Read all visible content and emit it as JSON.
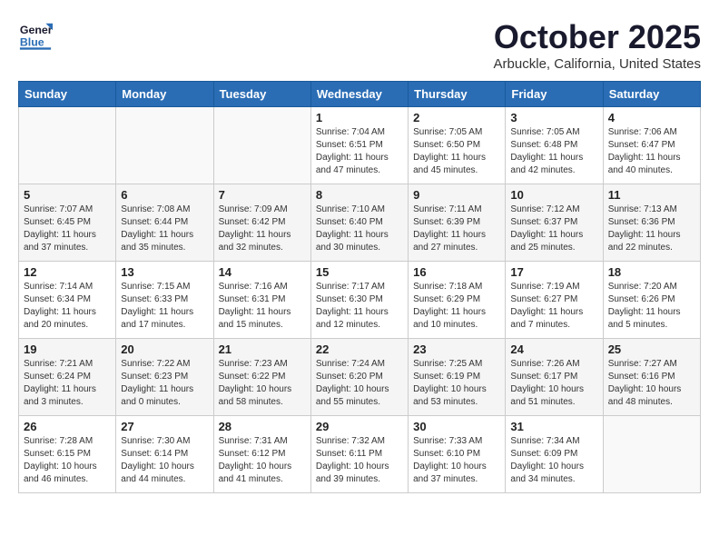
{
  "header": {
    "logo_general": "General",
    "logo_blue": "Blue",
    "month_title": "October 2025",
    "location": "Arbuckle, California, United States"
  },
  "weekdays": [
    "Sunday",
    "Monday",
    "Tuesday",
    "Wednesday",
    "Thursday",
    "Friday",
    "Saturday"
  ],
  "weeks": [
    [
      {
        "day": "",
        "sunrise": "",
        "sunset": "",
        "daylight": ""
      },
      {
        "day": "",
        "sunrise": "",
        "sunset": "",
        "daylight": ""
      },
      {
        "day": "",
        "sunrise": "",
        "sunset": "",
        "daylight": ""
      },
      {
        "day": "1",
        "sunrise": "Sunrise: 7:04 AM",
        "sunset": "Sunset: 6:51 PM",
        "daylight": "Daylight: 11 hours and 47 minutes."
      },
      {
        "day": "2",
        "sunrise": "Sunrise: 7:05 AM",
        "sunset": "Sunset: 6:50 PM",
        "daylight": "Daylight: 11 hours and 45 minutes."
      },
      {
        "day": "3",
        "sunrise": "Sunrise: 7:05 AM",
        "sunset": "Sunset: 6:48 PM",
        "daylight": "Daylight: 11 hours and 42 minutes."
      },
      {
        "day": "4",
        "sunrise": "Sunrise: 7:06 AM",
        "sunset": "Sunset: 6:47 PM",
        "daylight": "Daylight: 11 hours and 40 minutes."
      }
    ],
    [
      {
        "day": "5",
        "sunrise": "Sunrise: 7:07 AM",
        "sunset": "Sunset: 6:45 PM",
        "daylight": "Daylight: 11 hours and 37 minutes."
      },
      {
        "day": "6",
        "sunrise": "Sunrise: 7:08 AM",
        "sunset": "Sunset: 6:44 PM",
        "daylight": "Daylight: 11 hours and 35 minutes."
      },
      {
        "day": "7",
        "sunrise": "Sunrise: 7:09 AM",
        "sunset": "Sunset: 6:42 PM",
        "daylight": "Daylight: 11 hours and 32 minutes."
      },
      {
        "day": "8",
        "sunrise": "Sunrise: 7:10 AM",
        "sunset": "Sunset: 6:40 PM",
        "daylight": "Daylight: 11 hours and 30 minutes."
      },
      {
        "day": "9",
        "sunrise": "Sunrise: 7:11 AM",
        "sunset": "Sunset: 6:39 PM",
        "daylight": "Daylight: 11 hours and 27 minutes."
      },
      {
        "day": "10",
        "sunrise": "Sunrise: 7:12 AM",
        "sunset": "Sunset: 6:37 PM",
        "daylight": "Daylight: 11 hours and 25 minutes."
      },
      {
        "day": "11",
        "sunrise": "Sunrise: 7:13 AM",
        "sunset": "Sunset: 6:36 PM",
        "daylight": "Daylight: 11 hours and 22 minutes."
      }
    ],
    [
      {
        "day": "12",
        "sunrise": "Sunrise: 7:14 AM",
        "sunset": "Sunset: 6:34 PM",
        "daylight": "Daylight: 11 hours and 20 minutes."
      },
      {
        "day": "13",
        "sunrise": "Sunrise: 7:15 AM",
        "sunset": "Sunset: 6:33 PM",
        "daylight": "Daylight: 11 hours and 17 minutes."
      },
      {
        "day": "14",
        "sunrise": "Sunrise: 7:16 AM",
        "sunset": "Sunset: 6:31 PM",
        "daylight": "Daylight: 11 hours and 15 minutes."
      },
      {
        "day": "15",
        "sunrise": "Sunrise: 7:17 AM",
        "sunset": "Sunset: 6:30 PM",
        "daylight": "Daylight: 11 hours and 12 minutes."
      },
      {
        "day": "16",
        "sunrise": "Sunrise: 7:18 AM",
        "sunset": "Sunset: 6:29 PM",
        "daylight": "Daylight: 11 hours and 10 minutes."
      },
      {
        "day": "17",
        "sunrise": "Sunrise: 7:19 AM",
        "sunset": "Sunset: 6:27 PM",
        "daylight": "Daylight: 11 hours and 7 minutes."
      },
      {
        "day": "18",
        "sunrise": "Sunrise: 7:20 AM",
        "sunset": "Sunset: 6:26 PM",
        "daylight": "Daylight: 11 hours and 5 minutes."
      }
    ],
    [
      {
        "day": "19",
        "sunrise": "Sunrise: 7:21 AM",
        "sunset": "Sunset: 6:24 PM",
        "daylight": "Daylight: 11 hours and 3 minutes."
      },
      {
        "day": "20",
        "sunrise": "Sunrise: 7:22 AM",
        "sunset": "Sunset: 6:23 PM",
        "daylight": "Daylight: 11 hours and 0 minutes."
      },
      {
        "day": "21",
        "sunrise": "Sunrise: 7:23 AM",
        "sunset": "Sunset: 6:22 PM",
        "daylight": "Daylight: 10 hours and 58 minutes."
      },
      {
        "day": "22",
        "sunrise": "Sunrise: 7:24 AM",
        "sunset": "Sunset: 6:20 PM",
        "daylight": "Daylight: 10 hours and 55 minutes."
      },
      {
        "day": "23",
        "sunrise": "Sunrise: 7:25 AM",
        "sunset": "Sunset: 6:19 PM",
        "daylight": "Daylight: 10 hours and 53 minutes."
      },
      {
        "day": "24",
        "sunrise": "Sunrise: 7:26 AM",
        "sunset": "Sunset: 6:17 PM",
        "daylight": "Daylight: 10 hours and 51 minutes."
      },
      {
        "day": "25",
        "sunrise": "Sunrise: 7:27 AM",
        "sunset": "Sunset: 6:16 PM",
        "daylight": "Daylight: 10 hours and 48 minutes."
      }
    ],
    [
      {
        "day": "26",
        "sunrise": "Sunrise: 7:28 AM",
        "sunset": "Sunset: 6:15 PM",
        "daylight": "Daylight: 10 hours and 46 minutes."
      },
      {
        "day": "27",
        "sunrise": "Sunrise: 7:30 AM",
        "sunset": "Sunset: 6:14 PM",
        "daylight": "Daylight: 10 hours and 44 minutes."
      },
      {
        "day": "28",
        "sunrise": "Sunrise: 7:31 AM",
        "sunset": "Sunset: 6:12 PM",
        "daylight": "Daylight: 10 hours and 41 minutes."
      },
      {
        "day": "29",
        "sunrise": "Sunrise: 7:32 AM",
        "sunset": "Sunset: 6:11 PM",
        "daylight": "Daylight: 10 hours and 39 minutes."
      },
      {
        "day": "30",
        "sunrise": "Sunrise: 7:33 AM",
        "sunset": "Sunset: 6:10 PM",
        "daylight": "Daylight: 10 hours and 37 minutes."
      },
      {
        "day": "31",
        "sunrise": "Sunrise: 7:34 AM",
        "sunset": "Sunset: 6:09 PM",
        "daylight": "Daylight: 10 hours and 34 minutes."
      },
      {
        "day": "",
        "sunrise": "",
        "sunset": "",
        "daylight": ""
      }
    ]
  ]
}
